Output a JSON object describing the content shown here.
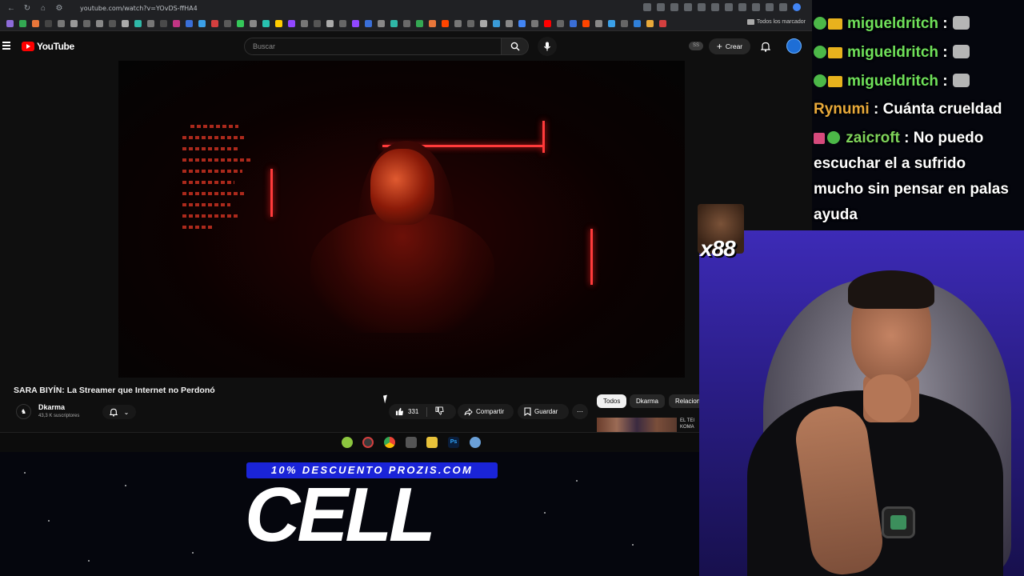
{
  "browser": {
    "url": "youtube.com/watch?v=YOvDS-ffHA4",
    "bookmarks_folder": "Todos los marcador"
  },
  "youtube": {
    "logo": "YouTube",
    "search_placeholder": "Buscar",
    "ss_badge": "SS",
    "create_label": "Crear",
    "video_title": "SARA BIYÍN: La Streamer que Internet no Perdonó",
    "channel_name": "Dkarma",
    "channel_subs": "43,3 K suscriptores",
    "likes": "331",
    "share_label": "Compartir",
    "save_label": "Guardar",
    "chips": [
      "Todos",
      "Dkarma",
      "Relacion"
    ],
    "related_text_1": "EL TEI",
    "related_text_2": "KOMA"
  },
  "chat": {
    "messages": [
      {
        "user": "migueldritch",
        "text": ":",
        "user_color": "#6fe05a"
      },
      {
        "user": "migueldritch",
        "text": ":",
        "user_color": "#6fe05a"
      },
      {
        "user": "migueldritch",
        "text": ":",
        "user_color": "#6fe05a"
      },
      {
        "user": "Rynumi",
        "text": ": Cuánta crueldad",
        "user_color": "#e8a93a"
      },
      {
        "user": "zaicroft",
        "text": ": No puedo",
        "user_color": "#7fd45a"
      }
    ],
    "wrap_lines": [
      "escuchar el a sufrido",
      "mucho sin pensar en palas",
      "ayuda"
    ],
    "emote_count": "x88"
  },
  "ad": {
    "pill_text": "10% DESCUENTO PROZIS.COM",
    "big_word": "CELL"
  },
  "colors": {
    "yt_red": "#ff0000",
    "ad_blue": "#1a24d8",
    "cam_purple": "#3d2bb7"
  }
}
